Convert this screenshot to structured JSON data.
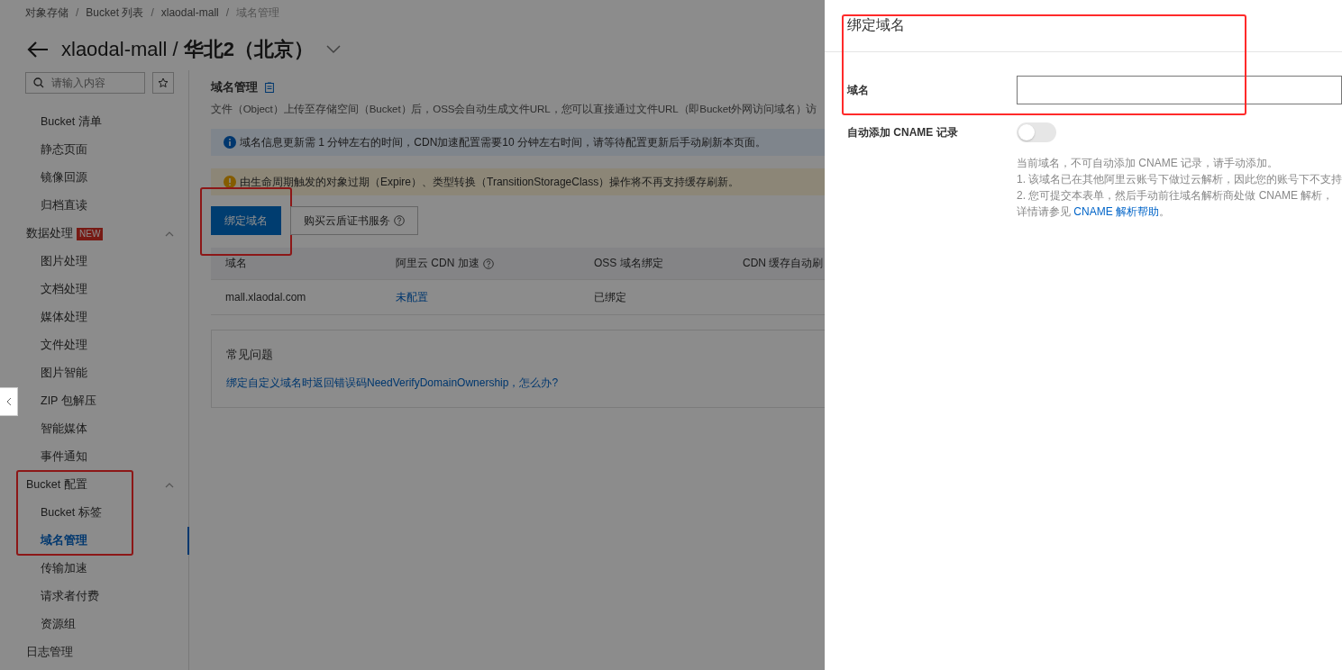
{
  "breadcrumb": [
    "对象存储",
    "Bucket 列表",
    "xlaodal-mall",
    "域名管理"
  ],
  "breadcrumb_separator": "/",
  "page_title": {
    "bucket": "xlaodal-mall / ",
    "region": "华北2（北京）"
  },
  "sidebar": {
    "search": {
      "placeholder": "请输入内容"
    },
    "items": [
      {
        "label": "Bucket 清单",
        "selected": false
      },
      {
        "label": "静态页面",
        "selected": false
      },
      {
        "label": "镜像回源",
        "selected": false
      },
      {
        "label": "归档直读",
        "selected": false
      }
    ],
    "groups": [
      {
        "label": "数据处理",
        "badge": "NEW",
        "expanded": true,
        "highlighted": false,
        "children": [
          {
            "label": "图片处理",
            "selected": false
          },
          {
            "label": "文档处理",
            "selected": false
          },
          {
            "label": "媒体处理",
            "selected": false
          },
          {
            "label": "文件处理",
            "selected": false
          },
          {
            "label": "图片智能",
            "selected": false
          },
          {
            "label": "ZIP 包解压",
            "selected": false
          },
          {
            "label": "智能媒体",
            "selected": false
          },
          {
            "label": "事件通知",
            "selected": false
          }
        ]
      },
      {
        "label": "Bucket 配置",
        "expanded": true,
        "highlighted": true,
        "children": [
          {
            "label": "Bucket 标签",
            "selected": false
          },
          {
            "label": "域名管理",
            "selected": true
          },
          {
            "label": "传输加速",
            "selected": false
          },
          {
            "label": "请求者付费",
            "selected": false
          },
          {
            "label": "资源组",
            "selected": false
          }
        ]
      },
      {
        "label": "日志管理"
      }
    ]
  },
  "main": {
    "title": "域名管理",
    "description": "文件（Object）上传至存储空间（Bucket）后，OSS会自动生成文件URL，您可以直接通过文件URL（即Bucket外网访问域名）访",
    "alerts": [
      {
        "kind": "info",
        "text": "域名信息更新需 1 分钟左右的时间，CDN加速配置需要10 分钟左右时间，请等待配置更新后手动刷新本页面。"
      },
      {
        "kind": "warning",
        "text": "由生命周期触发的对象过期（Expire）、类型转换（TransitionStorageClass）操作将不再支持缓存刷新。"
      }
    ],
    "buttons": [
      {
        "label": "绑定域名",
        "kind": "primary",
        "highlighted": true
      },
      {
        "label": "购买云盾证书服务",
        "kind": "secondary",
        "highlighted": false
      }
    ],
    "table": {
      "columns": [
        "域名",
        "阿里云 CDN 加速",
        "OSS 域名绑定",
        "CDN 缓存自动刷"
      ],
      "rows": [
        [
          "mall.xlaodal.com",
          "未配置",
          "已绑定"
        ]
      ]
    },
    "faq": {
      "title": "常见问题",
      "links": [
        "绑定自定义域名时返回错误码NeedVerifyDomainOwnership，怎么办?"
      ]
    }
  },
  "drawer": {
    "title": "绑定域名",
    "highlighted": true,
    "domain_field": {
      "label": "域名"
    },
    "auto_cname": {
      "label": "自动添加 CNAME 记录",
      "on": false
    },
    "help": [
      "当前域名，不可自动添加 CNAME 记录，请手动添加。",
      "1. 该域名已在其他阿里云账号下做过云解析，因此您的账号下不支持",
      "2. 您可提交本表单，然后手动前往域名解析商处做 CNAME 解析，"
    ],
    "help_link": {
      "prefix": "详情请参见 ",
      "link": "CNAME 解析帮助",
      "suffix": "。"
    }
  }
}
